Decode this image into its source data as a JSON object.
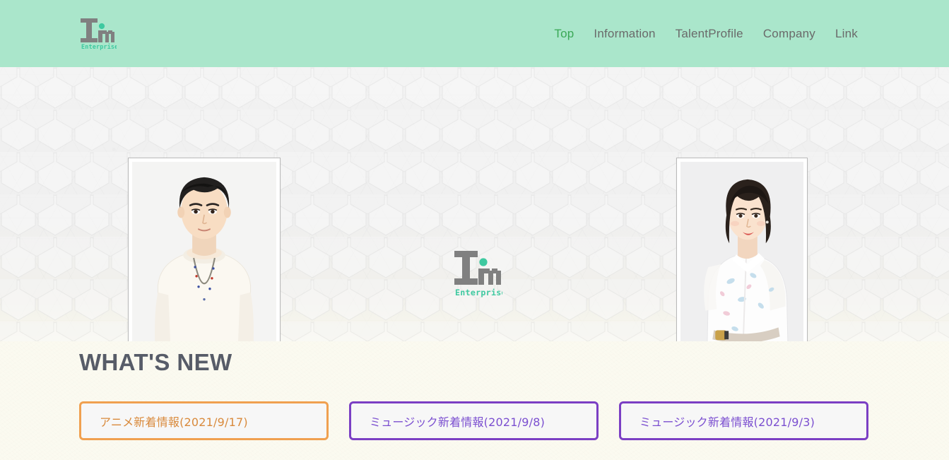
{
  "site": {
    "brand_name": "Im",
    "brand_tagline": "Enterprise",
    "header_bg": "#aae6cb",
    "accent_green": "#3aa856",
    "logo_gray": "#808080"
  },
  "header": {
    "logo_icon": "im-enterprise-logo-icon",
    "nav": [
      {
        "label": "Top",
        "active": true
      },
      {
        "label": "Information",
        "active": false
      },
      {
        "label": "TalentProfile",
        "active": false
      },
      {
        "label": "Company",
        "active": false
      },
      {
        "label": "Link",
        "active": false
      }
    ]
  },
  "hero": {
    "background_pattern": "hexagon-honeycomb",
    "center_logo_icon": "im-enterprise-logo-large-icon",
    "center_logo_tagline": "Enterprise",
    "photos": [
      {
        "name": "talent-photo-left",
        "alt": "male talent headshot in white sweater with beaded necklace"
      },
      {
        "name": "talent-photo-right",
        "alt": "female talent headshot in white floral dress"
      }
    ]
  },
  "whats_new": {
    "title": "WHAT'S NEW",
    "title_color": "#575c68",
    "cards": [
      {
        "label": "アニメ新着情報(2021/9/17)",
        "border_color": "#f0a050",
        "text_color": "#d98a3c",
        "theme": "orange"
      },
      {
        "label": "ミュージック新着情報(2021/9/8)",
        "border_color": "#7b3fc4",
        "text_color": "#7b4fd0",
        "theme": "purple"
      },
      {
        "label": "ミュージック新着情報(2021/9/3)",
        "border_color": "#7b3fc4",
        "text_color": "#7b4fd0",
        "theme": "purple"
      }
    ]
  }
}
